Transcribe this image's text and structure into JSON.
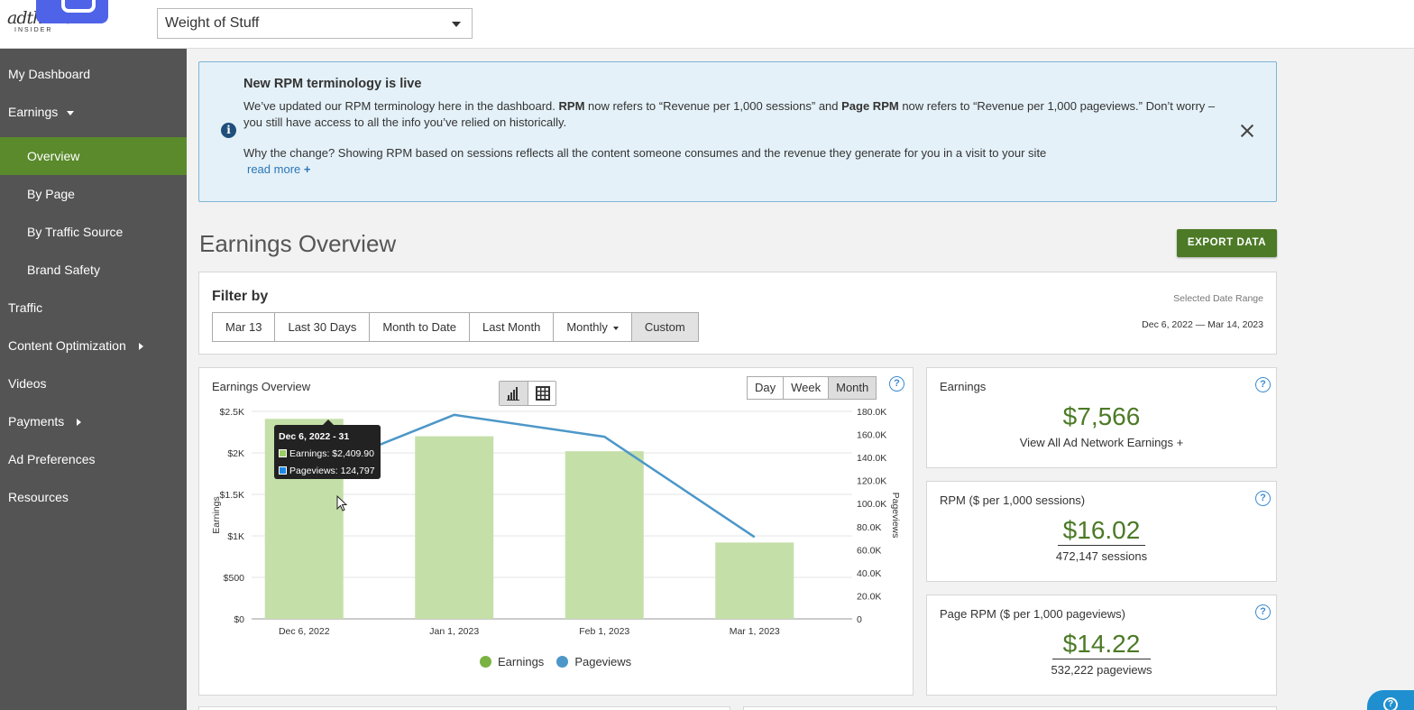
{
  "header": {
    "logo_brand": "adthrive",
    "logo_sub": "INSIDER",
    "site_selector_value": "Weight of Stuff"
  },
  "sidebar": {
    "items": [
      {
        "label": "My Dashboard"
      },
      {
        "label": "Earnings"
      },
      {
        "label": "Overview"
      },
      {
        "label": "By Page"
      },
      {
        "label": "By Traffic Source"
      },
      {
        "label": "Brand Safety"
      },
      {
        "label": "Traffic"
      },
      {
        "label": "Content Optimization"
      },
      {
        "label": "Videos"
      },
      {
        "label": "Payments"
      },
      {
        "label": "Ad Preferences"
      },
      {
        "label": "Resources"
      }
    ]
  },
  "notice": {
    "title": "New RPM terminology is live",
    "body_1": "We’ve updated our RPM terminology here in the dashboard. ",
    "body_rpm": "RPM",
    "body_2": " now refers to “Revenue per 1,000 sessions” and ",
    "body_page_rpm": "Page RPM",
    "body_3": " now refers to “Revenue per 1,000 pageviews.” Don’t worry – you still have access to all the info you’ve relied on historically.",
    "why": "Why the change? Showing RPM based on sessions reflects all the content someone consumes and the revenue they generate for you in a visit to your site",
    "read_more": "read more",
    "read_more_icon": "+"
  },
  "page_title": "Earnings Overview",
  "export_label": "EXPORT DATA",
  "filter": {
    "title": "Filter by",
    "buttons": [
      "Mar 13",
      "Last 30 Days",
      "Month to Date",
      "Last Month",
      "Monthly",
      "Custom"
    ],
    "date_range_label": "Selected Date Range",
    "date_range_value": "Dec 6, 2022 — Mar 14, 2023"
  },
  "chart_card": {
    "title": "Earnings Overview",
    "periods": [
      "Day",
      "Week",
      "Month"
    ],
    "selected_period": "Month",
    "help": "?"
  },
  "tooltip": {
    "title": "Dec 6, 2022 - 31",
    "earnings": "Earnings: $2,409.90",
    "pageviews": "Pageviews: 124,797"
  },
  "chart_data": {
    "type": "bar",
    "categories": [
      "Dec 6, 2022",
      "Jan 1, 2023",
      "Feb 1, 2023",
      "Mar 1, 2023"
    ],
    "series": [
      {
        "name": "Earnings",
        "type": "bar",
        "axis": "left",
        "color": "#c5dfa9",
        "values": [
          2409.9,
          2200,
          2020,
          920
        ]
      },
      {
        "name": "Pageviews",
        "type": "line",
        "axis": "right",
        "color": "#4c97c8",
        "values": [
          124797,
          177000,
          158000,
          71000
        ]
      }
    ],
    "ylabel": "Earnings",
    "y2label": "Pageviews",
    "ylim": [
      0,
      2500
    ],
    "y2lim": [
      0,
      180000
    ],
    "y_ticks": [
      "$0",
      "$500",
      "$1K",
      "$1.5K",
      "$2K",
      "$2.5K"
    ],
    "y2_ticks": [
      "0",
      "20.0K",
      "40.0K",
      "60.0K",
      "80.0K",
      "100.0K",
      "120.0K",
      "140.0K",
      "160.0K",
      "180.0K"
    ],
    "legend": [
      "Earnings",
      "Pageviews"
    ],
    "legend_colors": [
      "#7bb342",
      "#4c97c8"
    ],
    "legend_position": "bottom",
    "grid": true
  },
  "stats": {
    "earnings": {
      "title": "Earnings",
      "value": "$7,566",
      "sub": "View All Ad Network Earnings +",
      "help": "?"
    },
    "rpm": {
      "title": "RPM ($ per 1,000 sessions)",
      "value": "$16.02",
      "sub": "472,147 sessions",
      "help": "?"
    },
    "page_rpm": {
      "title": "Page RPM ($ per 1,000 pageviews)",
      "value": "$14.22",
      "sub": "532,222 pageviews",
      "help": "?"
    }
  },
  "chat_help": "?"
}
